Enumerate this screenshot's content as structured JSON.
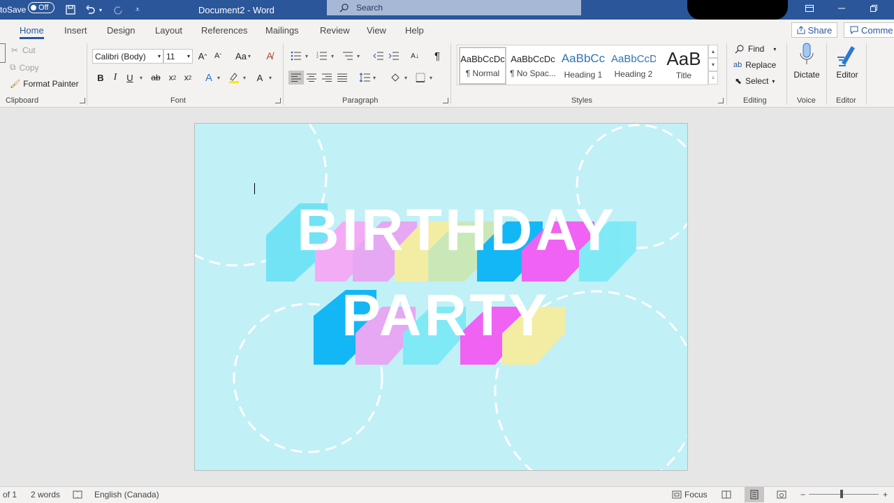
{
  "titlebar": {
    "autosave_label": "toSave",
    "autosave_state": "Off",
    "doc_title": "Document2  -  Word",
    "search_placeholder": "Search",
    "color": "#2b579a"
  },
  "tabs": [
    "Home",
    "Insert",
    "Design",
    "Layout",
    "References",
    "Mailings",
    "Review",
    "View",
    "Help"
  ],
  "share_label": "Share",
  "comments_label": "Comme",
  "clipboard": {
    "cut": "Cut",
    "copy": "Copy",
    "format_painter": "Format Painter",
    "label": "Clipboard"
  },
  "font": {
    "name": "Calibri (Body)",
    "size": "11",
    "label": "Font",
    "change_case": "Aa"
  },
  "paragraph": {
    "label": "Paragraph"
  },
  "styles": {
    "label": "Styles",
    "items": [
      {
        "sample": "AaBbCcDc",
        "name": "¶ Normal"
      },
      {
        "sample": "AaBbCcDc",
        "name": "¶ No Spac..."
      },
      {
        "sample": "AaBbCc",
        "name": "Heading 1"
      },
      {
        "sample": "AaBbCcD",
        "name": "Heading 2"
      },
      {
        "sample": "AaB",
        "name": "Title"
      }
    ]
  },
  "editing": {
    "find": "Find",
    "replace": "Replace",
    "select": "Select",
    "label": "Editing"
  },
  "voice": {
    "dictate": "Dictate",
    "label": "Voice"
  },
  "editor": {
    "editor": "Editor",
    "label": "Editor"
  },
  "document": {
    "line1": "BIRTHDAY",
    "line2": "PARTY",
    "background": "#c1f0f7"
  },
  "status": {
    "page": "of 1",
    "words": "2 words",
    "language": "English (Canada)",
    "focus": "Focus"
  }
}
